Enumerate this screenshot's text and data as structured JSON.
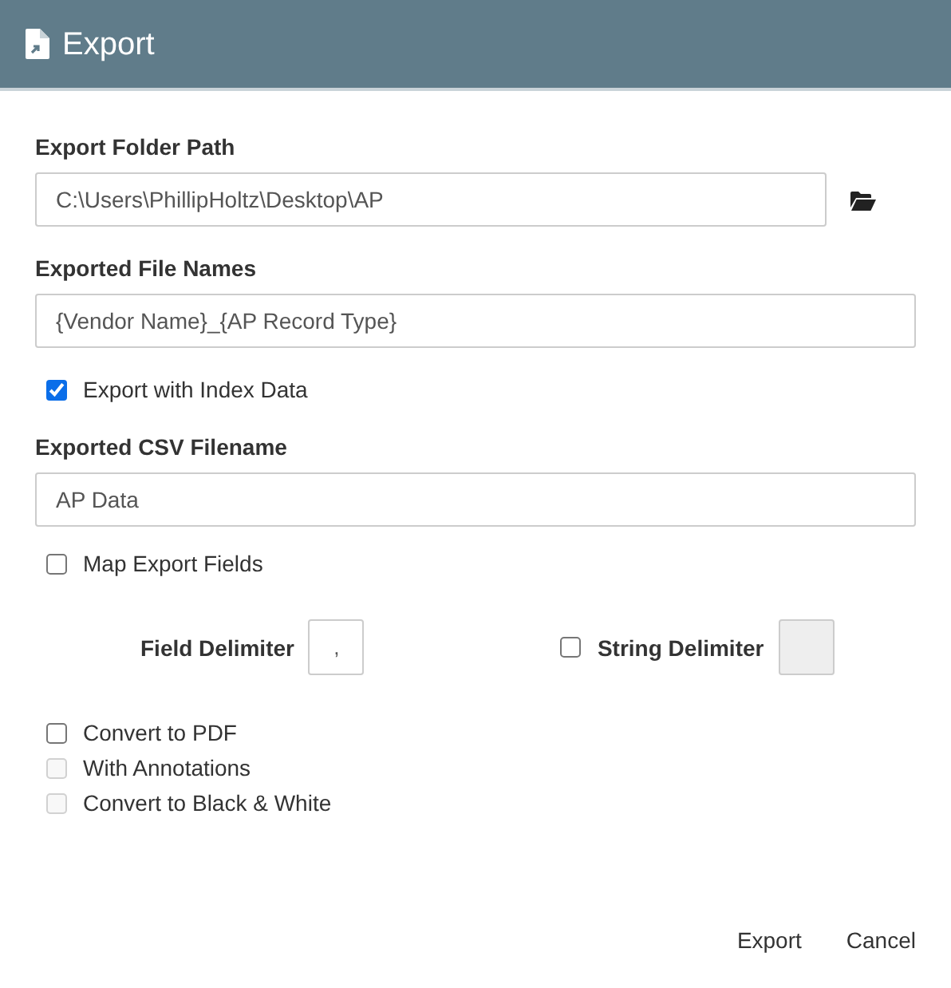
{
  "dialog": {
    "title": "Export"
  },
  "folder_path": {
    "label": "Export Folder Path",
    "value": "C:\\Users\\PhillipHoltz\\Desktop\\AP"
  },
  "file_names": {
    "label": "Exported File Names",
    "value": "{Vendor Name}_{AP Record Type}"
  },
  "export_index": {
    "label": "Export with Index Data",
    "checked": true
  },
  "csv_filename": {
    "label": "Exported CSV Filename",
    "value": "AP Data"
  },
  "map_fields": {
    "label": "Map Export Fields",
    "checked": false
  },
  "field_delimiter": {
    "label": "Field Delimiter",
    "value": ","
  },
  "string_delimiter": {
    "label": "String Delimiter",
    "checked": false
  },
  "pdf_options": [
    {
      "label": "Convert to PDF",
      "checked": false,
      "disabled": false
    },
    {
      "label": "With Annotations",
      "checked": false,
      "disabled": true
    },
    {
      "label": "Convert to Black & White",
      "checked": false,
      "disabled": true
    }
  ],
  "buttons": [
    "Export",
    "Cancel"
  ]
}
